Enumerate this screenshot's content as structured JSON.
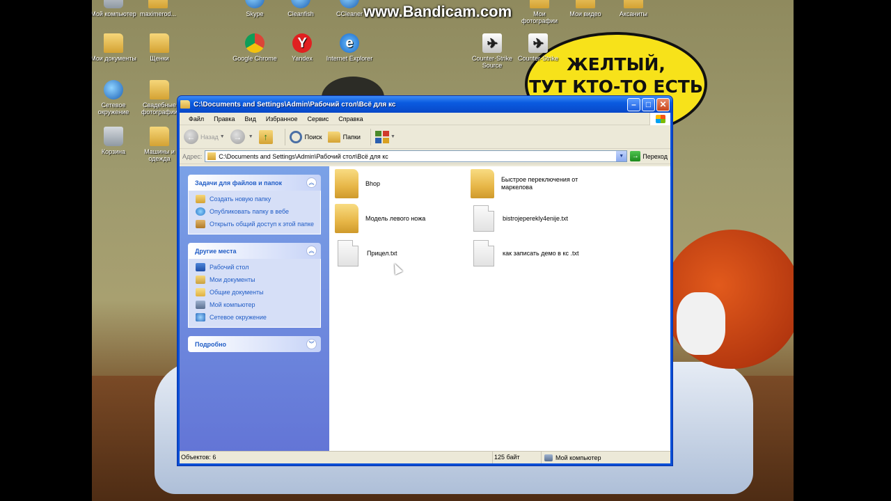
{
  "watermark": "www.Bandicam.com",
  "bubble": {
    "line1": "ЖЕЛТЫЙ,",
    "line2": "ТУТ КТО-ТО ЕСТЬ"
  },
  "desktop_icons": [
    {
      "label": "Мой компьютер"
    },
    {
      "label": "maximerod..."
    },
    {
      "label": "Skype"
    },
    {
      "label": "Cleanfish"
    },
    {
      "label": "CCleaner"
    },
    {
      "label": "Мои фотографии"
    },
    {
      "label": "Мои видео"
    },
    {
      "label": "Аксаниты"
    },
    {
      "label": "Мои документы"
    },
    {
      "label": "Щенки"
    },
    {
      "label": "Google Chrome"
    },
    {
      "label": "Yandex"
    },
    {
      "label": "Internet Explorer"
    },
    {
      "label": "Counter-Strike Source"
    },
    {
      "label": "Counter-Strike"
    },
    {
      "label": "Сетевое окружение"
    },
    {
      "label": "Свадебные фотографии"
    },
    {
      "label": "Корзина"
    },
    {
      "label": "Машины и одежда"
    }
  ],
  "window": {
    "title": "C:\\Documents and Settings\\Admin\\Рабочий стол\\Всё для кс",
    "menu": [
      "Файл",
      "Правка",
      "Вид",
      "Избранное",
      "Сервис",
      "Справка"
    ],
    "toolbar": {
      "back": "Назад",
      "search": "Поиск",
      "folders": "Папки"
    },
    "address": {
      "label": "Адрес:",
      "value": "C:\\Documents and Settings\\Admin\\Рабочий стол\\Всё для кс",
      "go": "Переход"
    },
    "tasks": {
      "title": "Задачи для файлов и папок",
      "items": [
        "Создать новую папку",
        "Опубликовать папку в вебе",
        "Открыть общий доступ к этой папке"
      ]
    },
    "places": {
      "title": "Другие места",
      "items": [
        "Рабочий стол",
        "Мои документы",
        "Общие документы",
        "Мой компьютер",
        "Сетевое окружение"
      ]
    },
    "details": {
      "title": "Подробно"
    },
    "files": [
      {
        "name": "Bhop",
        "type": "folder"
      },
      {
        "name": "Быстрое переключения от маркелова",
        "type": "folder"
      },
      {
        "name": "Модель левого ножа",
        "type": "folder"
      },
      {
        "name": "bistrojeperekly4enije.txt",
        "type": "txt"
      },
      {
        "name": "Прицел.txt",
        "type": "txt"
      },
      {
        "name": "как записать демо в кс .txt",
        "type": "txt"
      }
    ],
    "status": {
      "objects": "Объектов: 6",
      "size": "125 байт",
      "zone": "Мой компьютер"
    }
  }
}
